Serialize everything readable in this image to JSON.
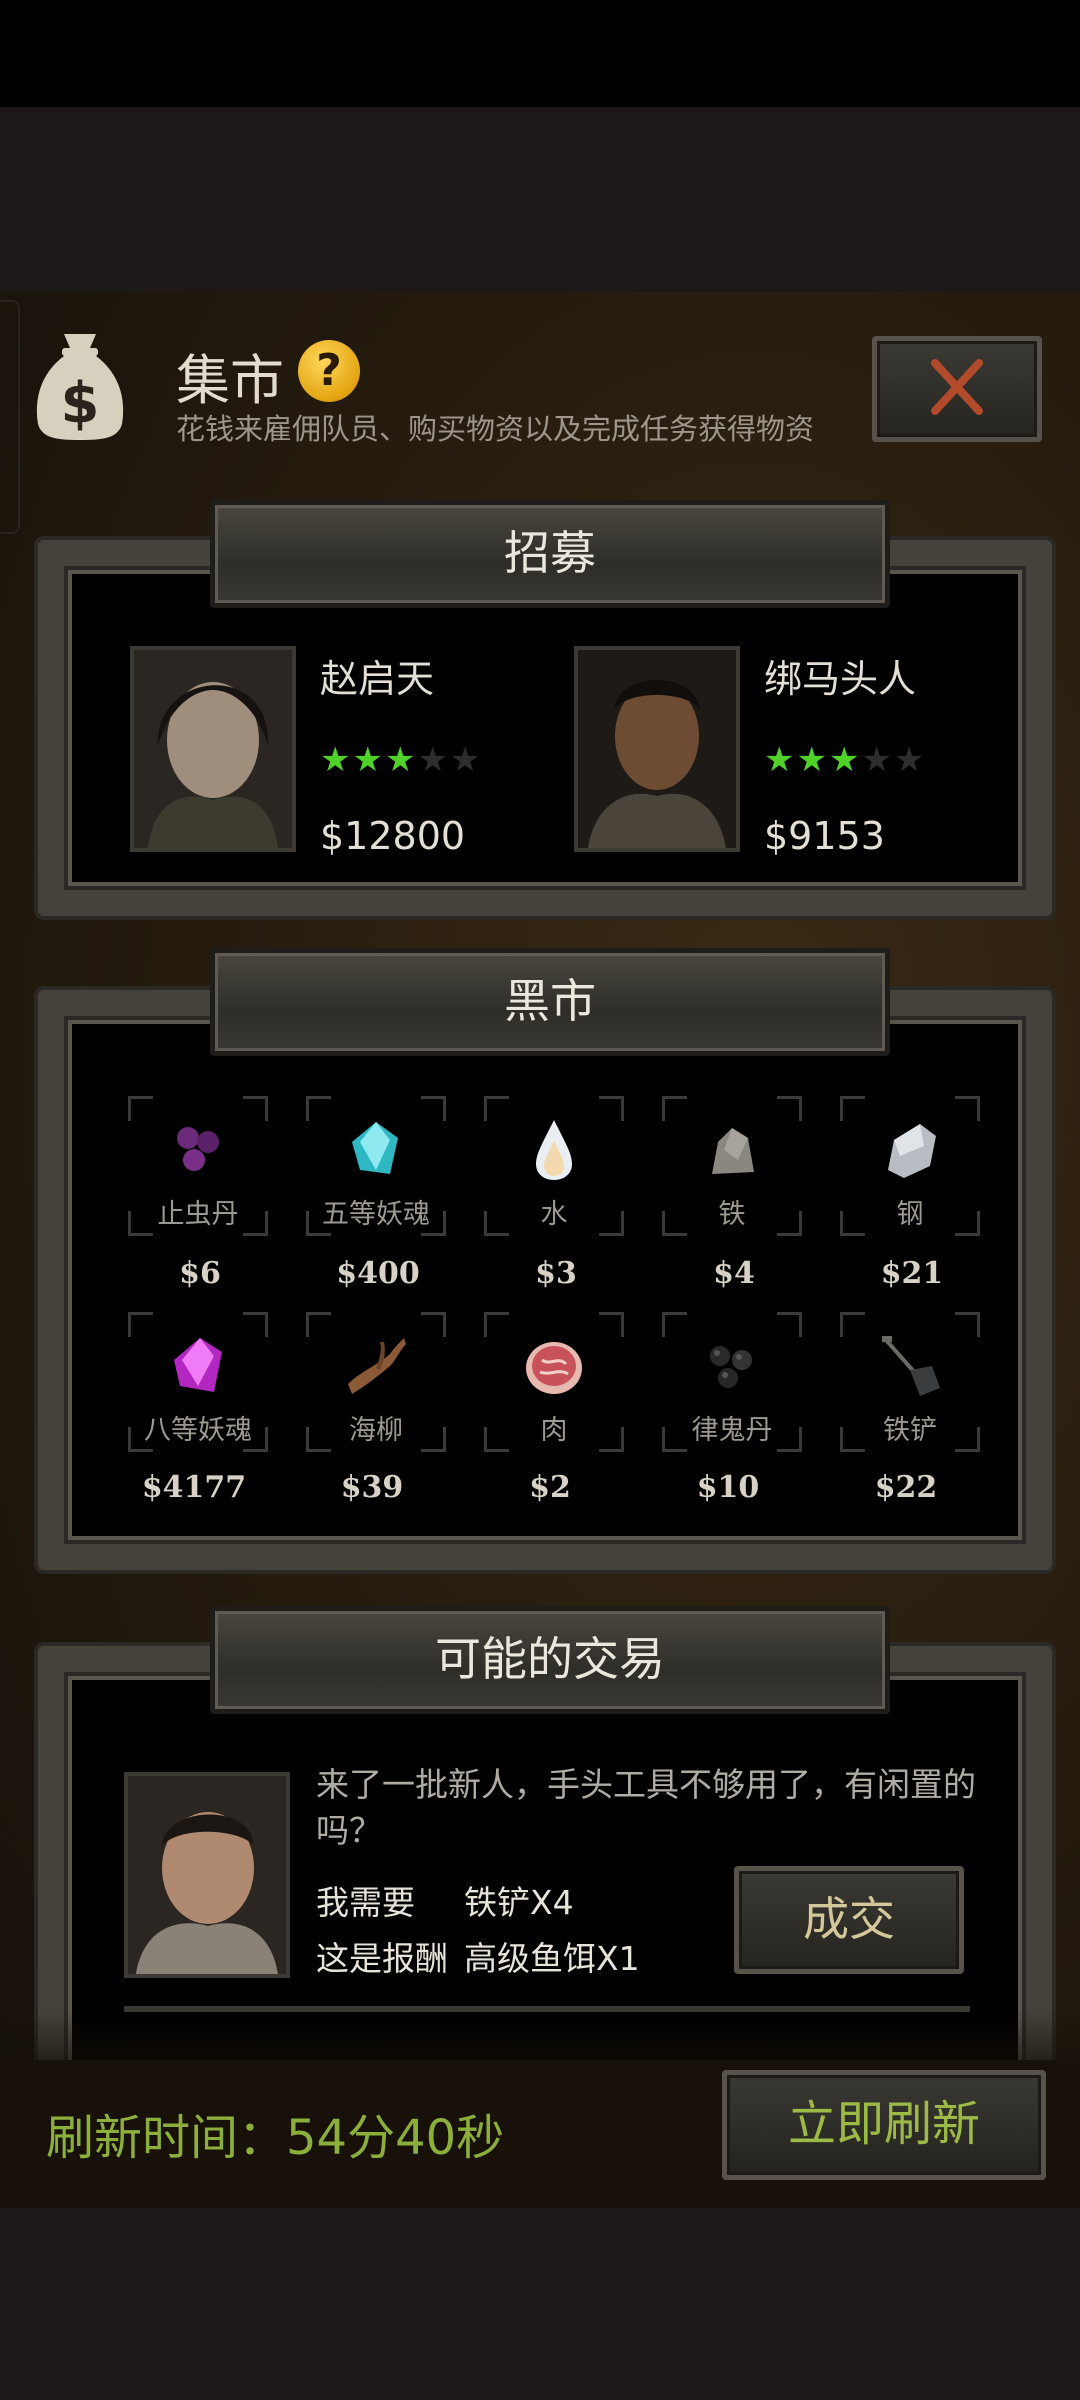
{
  "header": {
    "title": "集市",
    "help_icon": "question-mark-icon",
    "subtitle": "花钱来雇佣队员、购买物资以及完成任务获得物资",
    "close_icon": "close-x-icon"
  },
  "recruit": {
    "section_title": "招募",
    "candidates": [
      {
        "name": "赵启天",
        "stars": 3,
        "max_stars": 5,
        "price": "$12800"
      },
      {
        "name": "绑马头人",
        "stars": 3,
        "max_stars": 5,
        "price": "$9153"
      }
    ]
  },
  "market": {
    "section_title": "黑市",
    "items": [
      {
        "name": "止虫丹",
        "price": "$6",
        "icon": "purple-pills-icon"
      },
      {
        "name": "五等妖魂",
        "price": "$400",
        "icon": "cyan-crystal-icon"
      },
      {
        "name": "水",
        "price": "$3",
        "icon": "water-drop-icon"
      },
      {
        "name": "铁",
        "price": "$4",
        "icon": "iron-ore-icon"
      },
      {
        "name": "钢",
        "price": "$21",
        "icon": "steel-ore-icon"
      },
      {
        "name": "八等妖魂",
        "price": "$4177",
        "icon": "pink-crystal-icon"
      },
      {
        "name": "海柳",
        "price": "$39",
        "icon": "driftwood-icon"
      },
      {
        "name": "肉",
        "price": "$2",
        "icon": "meat-icon"
      },
      {
        "name": "律鬼丹",
        "price": "$10",
        "icon": "black-pills-icon"
      },
      {
        "name": "铁铲",
        "price": "$22",
        "icon": "shovel-icon"
      }
    ]
  },
  "trade": {
    "section_title": "可能的交易",
    "message": "来了一批新人，手头工具不够用了，有闲置的吗？",
    "need_label": "我需要",
    "need_value": "铁铲X4",
    "reward_label": "这是报酬",
    "reward_value": "高级鱼饵X1",
    "deal_button": "成交"
  },
  "footer": {
    "refresh_time": "刷新时间：54分40秒",
    "refresh_button": "立即刷新"
  }
}
